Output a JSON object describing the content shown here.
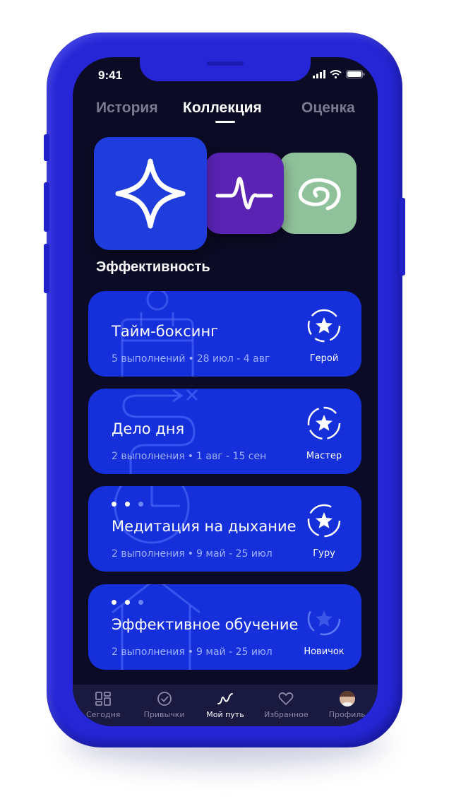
{
  "status_bar": {
    "time": "9:41"
  },
  "tabs": [
    {
      "label": "История"
    },
    {
      "label": "Коллекция"
    },
    {
      "label": "Оценка"
    }
  ],
  "active_tab": "Коллекция",
  "badges": [
    {
      "icon": "four-point-star-icon",
      "color": "#1f3cdc"
    },
    {
      "icon": "heartbeat-pulse-icon",
      "color": "#5a23b4"
    },
    {
      "icon": "spiral-icon",
      "color": "#8fc19a"
    }
  ],
  "section": {
    "title": "Эффективность"
  },
  "cards": [
    {
      "title": "Тайм-боксинг",
      "count": "5 выполнений",
      "separator": "•",
      "dates": "28 июл - 4 авг",
      "rank": "Герой"
    },
    {
      "title": "Дело дня",
      "count": "2 выполнения",
      "separator": "•",
      "dates": "1 авг - 15 сен",
      "rank": "Мастер"
    },
    {
      "title": "Медитация на дыхание",
      "count": "2 выполнения",
      "separator": "•",
      "dates": "9 май - 25 июл",
      "rank": "Гуру"
    },
    {
      "title": "Эффективное обучение",
      "count": "2 выполнения",
      "separator": "•",
      "dates": "9 май - 25 июл",
      "rank": "Новичок"
    }
  ],
  "tabbar": [
    {
      "label": "Сегодня",
      "icon": "dashboard-icon"
    },
    {
      "label": "Привычки",
      "icon": "check-circle-icon"
    },
    {
      "label": "Мой путь",
      "icon": "path-icon"
    },
    {
      "label": "Избранное",
      "icon": "heart-icon"
    },
    {
      "label": "Профиль",
      "icon": "avatar"
    }
  ],
  "colors": {
    "phone": "#2626d6",
    "screen": "#0c0b26",
    "card": "#1530db",
    "accent_purple": "#5a23b4",
    "accent_green": "#8fc19a"
  }
}
